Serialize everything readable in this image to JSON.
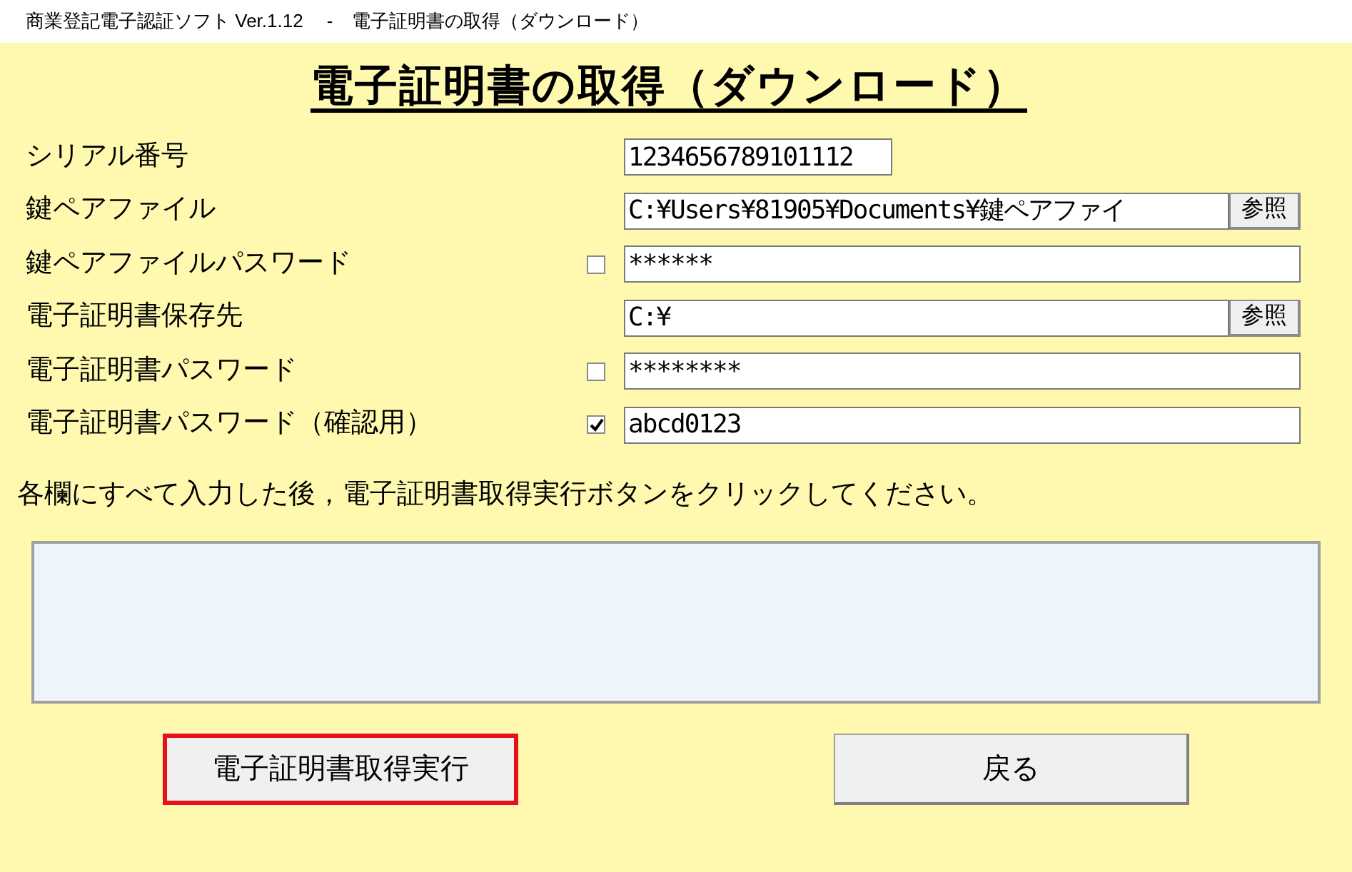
{
  "window": {
    "title": "商業登記電子認証ソフト Ver.1.12　 -　電子証明書の取得（ダウンロード）"
  },
  "heading": "電子証明書の取得（ダウンロード）",
  "rows": [
    {
      "kind": "short",
      "label": "シリアル番号",
      "value": "1234656789101112"
    },
    {
      "kind": "browse",
      "label": "鍵ペアファイル",
      "value": "C:¥Users¥81905¥Documents¥鍵ペアファイ",
      "button": "参照"
    },
    {
      "kind": "plain",
      "label": "鍵ペアファイルパスワード",
      "value": "******",
      "checked": false
    },
    {
      "kind": "browse",
      "label": "電子証明書保存先",
      "value": "C:¥",
      "button": "参照"
    },
    {
      "kind": "plain",
      "label": "電子証明書パスワード",
      "value": "********",
      "checked": false
    },
    {
      "kind": "plain",
      "label": "電子証明書パスワード（確認用）",
      "value": "abcd0123",
      "checked": true
    }
  ],
  "instruction": "各欄にすべて入力した後，電子証明書取得実行ボタンをクリックしてください。",
  "buttons": [
    {
      "label": "電子証明書取得実行",
      "highlighted": true
    },
    {
      "label": "戻る",
      "highlighted": false
    }
  ]
}
